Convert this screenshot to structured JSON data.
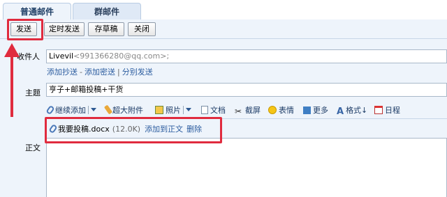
{
  "tabs": [
    {
      "label": "普通邮件",
      "active": true
    },
    {
      "label": "群邮件",
      "active": false
    }
  ],
  "toolbar": {
    "send": "发送",
    "timed_send": "定时发送",
    "save_draft": "存草稿",
    "close": "关闭"
  },
  "form": {
    "to_label": "收件人",
    "to_name": "Livevil",
    "to_address": "<991366280@qq.com>;",
    "add_cc": "添加抄送",
    "add_bcc": "添加密送",
    "separate_send": "分别发送",
    "subject_label": "主题",
    "subject_value": "亨子+邮箱投稿+干货",
    "body_label": "正文"
  },
  "editor_toolbar": {
    "continue_add": "继续添加",
    "large_attachment": "超大附件",
    "photo": "照片",
    "document": "文档",
    "screenshot": "截屏",
    "emoji": "表情",
    "more": "更多",
    "format": "格式↓",
    "calendar": "日程"
  },
  "attachment": {
    "filename": "我要投稿.docx",
    "size": "(12.0K)",
    "add_to_body": "添加到正文",
    "delete": "删除"
  },
  "colors": {
    "highlight": "#e02b3e",
    "link": "#2b5c9f",
    "panel": "#eef4fb"
  }
}
